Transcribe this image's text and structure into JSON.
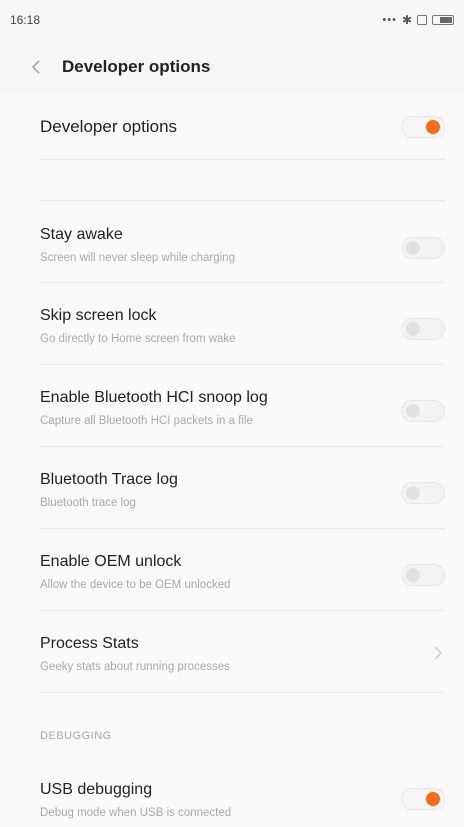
{
  "status_bar": {
    "time": "16:18",
    "icons": [
      "signal-dots-icon",
      "bluetooth-icon",
      "sim-icon",
      "battery-icon"
    ]
  },
  "header": {
    "title": "Developer options",
    "back_icon": "chevron-left-icon"
  },
  "master_toggle": {
    "label": "Developer options",
    "enabled": true
  },
  "items": [
    {
      "title": "Stay awake",
      "subtitle": "Screen will never sleep while charging",
      "control": "toggle",
      "enabled": false
    },
    {
      "title": "Skip screen lock",
      "subtitle": "Go directly to Home screen from wake",
      "control": "toggle",
      "enabled": false
    },
    {
      "title": "Enable Bluetooth HCI snoop log",
      "subtitle": "Capture all Bluetooth HCI packets in a file",
      "control": "toggle",
      "enabled": false
    },
    {
      "title": "Bluetooth Trace log",
      "subtitle": "Bluetooth trace log",
      "control": "toggle",
      "enabled": false
    },
    {
      "title": "Enable OEM unlock",
      "subtitle": "Allow the device to be OEM unlocked",
      "control": "toggle",
      "enabled": false
    },
    {
      "title": "Process Stats",
      "subtitle": "Geeky stats about running processes",
      "control": "chevron"
    }
  ],
  "debugging": {
    "section_label": "DEBUGGING",
    "usb_debugging": {
      "title": "USB debugging",
      "subtitle": "Debug mode when USB is connected",
      "enabled": true
    }
  },
  "colors": {
    "accent": "#ff6a13",
    "background": "#f7f7f7"
  }
}
